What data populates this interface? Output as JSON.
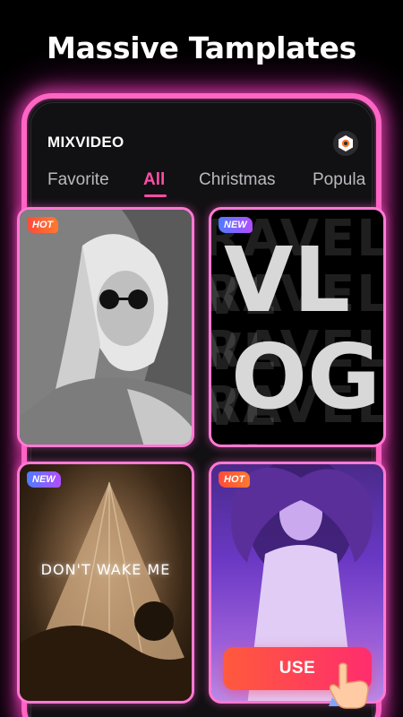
{
  "headline": "Massive Tamplates",
  "app": {
    "title": "MIXVIDEO"
  },
  "tabs": [
    {
      "label": "Favorite"
    },
    {
      "label": "All"
    },
    {
      "label": "Christmas"
    },
    {
      "label": "Popula"
    }
  ],
  "cards": [
    {
      "badge": "HOT"
    },
    {
      "badge": "NEW",
      "bg_text": "RAVEL VL",
      "big_text_top": "VL",
      "big_text_bottom": "OG"
    },
    {
      "badge": "NEW",
      "caption": "DON'T WAKE ME"
    },
    {
      "badge": "HOT"
    }
  ],
  "use_button": {
    "label": "USE"
  },
  "colors": {
    "accent": "#ff4da6",
    "frame": "#ff66c4",
    "use_start": "#ff5a3c",
    "use_end": "#ff2d6e"
  },
  "icons": {
    "settings": "settings-icon",
    "pointer": "pointing-hand-icon"
  }
}
